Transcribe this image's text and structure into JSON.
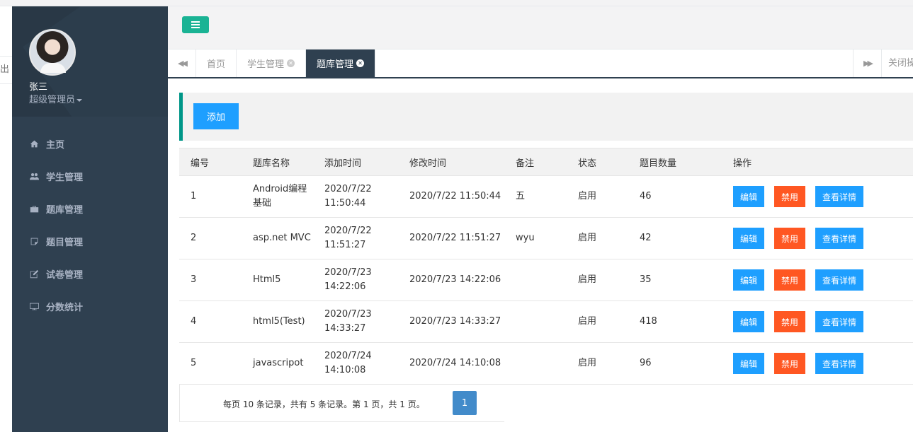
{
  "left_strip": {
    "cut_text": "出"
  },
  "user": {
    "name": "张三",
    "role": "超级管理员"
  },
  "nav": {
    "items": [
      {
        "label": "主页",
        "icon": "home-icon"
      },
      {
        "label": "学生管理",
        "icon": "users-icon"
      },
      {
        "label": "题库管理",
        "icon": "briefcase-icon"
      },
      {
        "label": "题目管理",
        "icon": "note-icon"
      },
      {
        "label": "试卷管理",
        "icon": "edit-icon"
      },
      {
        "label": "分数统计",
        "icon": "monitor-icon"
      }
    ]
  },
  "tabs": [
    {
      "label": "首页",
      "closable": false,
      "active": false
    },
    {
      "label": "学生管理",
      "closable": true,
      "active": false
    },
    {
      "label": "题库管理",
      "closable": true,
      "active": true
    }
  ],
  "tab_controls": {
    "close_ops": "关闭操作"
  },
  "toolbar": {
    "add_label": "添加"
  },
  "table": {
    "headers": [
      "编号",
      "题库名称",
      "添加时间",
      "修改时间",
      "备注",
      "状态",
      "题目数量",
      "操作"
    ],
    "rows": [
      {
        "id": "1",
        "name": "Android编程基础",
        "added": "2020/7/22 11:50:44",
        "modified": "2020/7/22 11:50:44",
        "note": "五",
        "status": "启用",
        "count": "46"
      },
      {
        "id": "2",
        "name": "asp.net MVC",
        "added": "2020/7/22 11:51:27",
        "modified": "2020/7/22 11:51:27",
        "note": "wyu",
        "status": "启用",
        "count": "42"
      },
      {
        "id": "3",
        "name": "Html5",
        "added": "2020/7/23 14:22:06",
        "modified": "2020/7/23 14:22:06",
        "note": "",
        "status": "启用",
        "count": "35"
      },
      {
        "id": "4",
        "name": "html5(Test)",
        "added": "2020/7/23 14:33:27",
        "modified": "2020/7/23 14:33:27",
        "note": "",
        "status": "启用",
        "count": "418"
      },
      {
        "id": "5",
        "name": "javascripot",
        "added": "2020/7/24 14:10:08",
        "modified": "2020/7/24 14:10:08",
        "note": "",
        "status": "启用",
        "count": "96"
      }
    ],
    "actions": {
      "edit": "编辑",
      "disable": "禁用",
      "detail": "查看详情"
    }
  },
  "pager": {
    "summary": "每页 10 条记录，共有 5 条记录。第 1 页，共 1 页。",
    "current_page": "1"
  },
  "colors": {
    "sidebar": "#2f4050",
    "accent_green": "#1ab394",
    "teal": "#009688",
    "blue": "#1e9fff",
    "orange": "#ff5722",
    "page_blue": "#428bca"
  }
}
